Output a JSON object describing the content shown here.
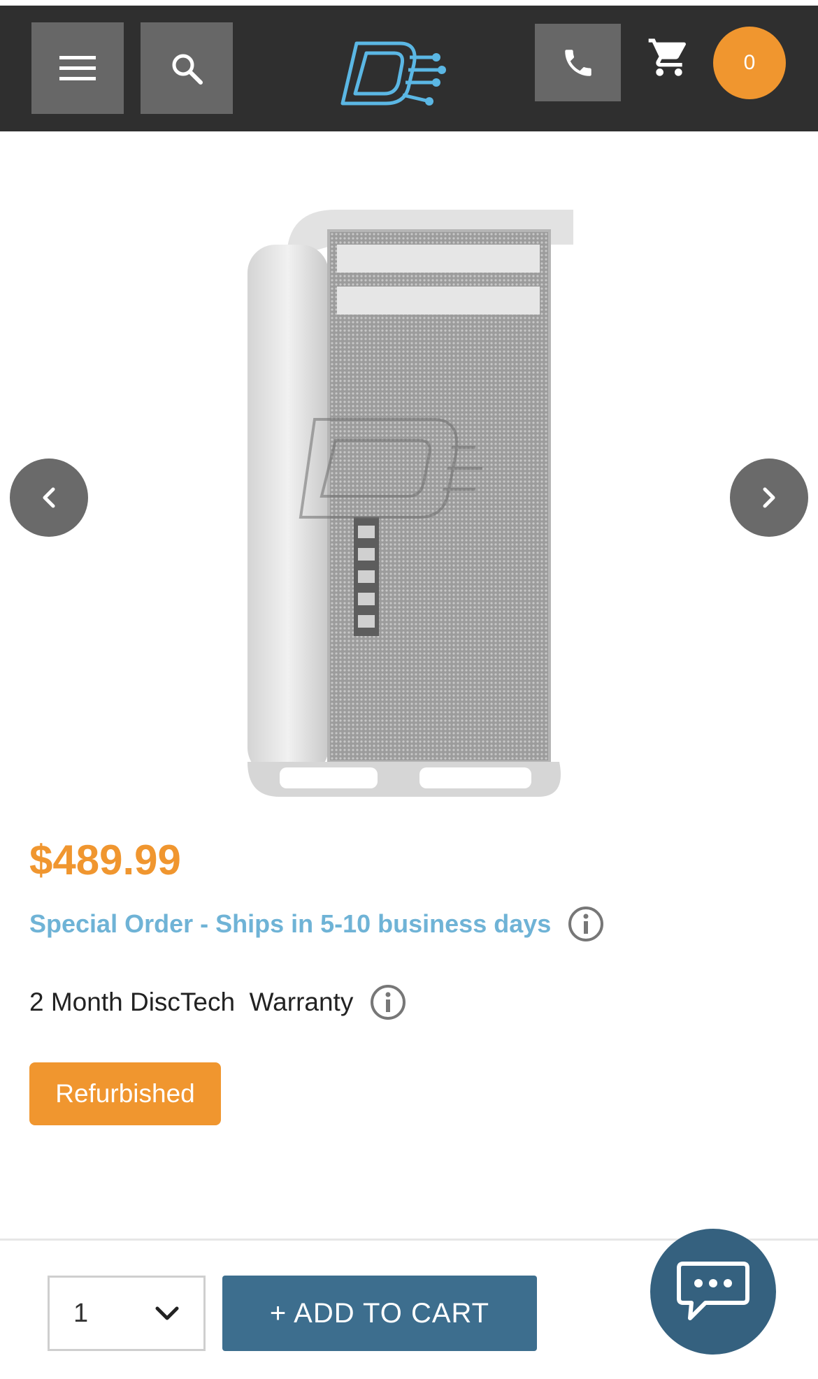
{
  "header": {
    "menu_icon": "hamburger-menu-icon",
    "search_icon": "search-icon",
    "logo": "disctech-logo",
    "phone_icon": "phone-icon",
    "cart_icon": "shopping-cart-icon",
    "cart_count": "0"
  },
  "gallery": {
    "prev_icon": "chevron-left-icon",
    "next_icon": "chevron-right-icon",
    "image": "mac-pro-tower-image"
  },
  "product": {
    "price": "$489.99",
    "availability": "Special Order - Ships in 5-10 business days",
    "warranty": "2 Month DiscTech  Warranty",
    "condition": "Refurbished"
  },
  "purchase": {
    "quantity": "1",
    "add_to_cart_label": "+ ADD TO CART",
    "chat_icon": "chat-bubble-icon"
  },
  "colors": {
    "header_bg": "#2f2f2f",
    "accent_orange": "#f0962f",
    "link_blue": "#6fb3d6",
    "button_blue": "#3d6e8e"
  }
}
